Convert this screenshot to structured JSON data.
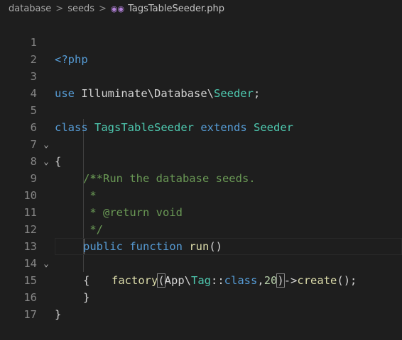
{
  "breadcrumb": {
    "items": [
      "database",
      "seeds"
    ],
    "separator": ">",
    "file_icon": "php-elephant-icon",
    "file_name": "TagsTableSeeder.php"
  },
  "editor": {
    "line_numbers": [
      "1",
      "2",
      "3",
      "4",
      "5",
      "6",
      "7",
      "8",
      "9",
      "10",
      "11",
      "12",
      "13",
      "14",
      "15",
      "16",
      "17"
    ],
    "fold_markers": {
      "6": "⌄",
      "7": "⌄",
      "13": "⌄"
    },
    "lines": {
      "l1": {
        "open": "<?php"
      },
      "l3": {
        "use": "use",
        "ns": "Illuminate\\Database\\",
        "cls": "Seeder",
        "end": ";"
      },
      "l5": {
        "class": "class",
        "name": "TagsTableSeeder",
        "extends": "extends",
        "parent": "Seeder"
      },
      "l6": {
        "brace": "{"
      },
      "l7": {
        "comment": "/**"
      },
      "l8": {
        "comment": " * Run the database seeds."
      },
      "l9": {
        "comment": " *"
      },
      "l10": {
        "star": " * ",
        "tag": "@return",
        "type": " void"
      },
      "l11": {
        "comment": " */"
      },
      "l12": {
        "public": "public",
        "function": "function",
        "name": "run",
        "parens": "()"
      },
      "l13": {
        "brace": "{"
      },
      "l14": {
        "fn": "factory",
        "open": "(",
        "ns": "App\\",
        "cls": "Tag",
        "dc": "::",
        "kw": "class",
        "comma": ",",
        "num": "20",
        "close": ")",
        "arrow": "->",
        "method": "create",
        "end": "();"
      },
      "l15": {
        "brace": "}"
      },
      "l16": {
        "brace": "}"
      }
    }
  },
  "colors": {
    "background": "#1e1e1e",
    "keyword": "#569cd6",
    "class": "#4ec9b0",
    "comment": "#6a9955",
    "function": "#dcdcaa",
    "number": "#b5cea8"
  }
}
